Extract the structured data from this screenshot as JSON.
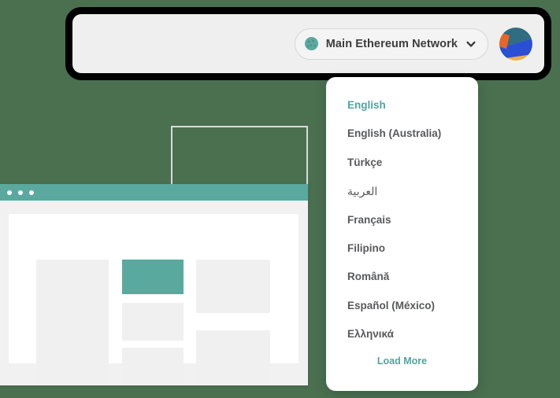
{
  "background": {
    "color": "#4a7050"
  },
  "header": {
    "panel_bg": "#efefef",
    "border_color": "#000000",
    "network_selector": {
      "label": "Main Ethereum Network",
      "status_dot_color": "#5aa99f",
      "chevron_icon": "chevron-down-icon"
    },
    "account_avatar": {
      "icon": "account-identicon-avatar",
      "colors": [
        "#2f6d83",
        "#2b4fd4",
        "#e8b04b",
        "#e8662a"
      ]
    }
  },
  "language_dropdown": {
    "accent_color": "#4fa59c",
    "text_color": "#58595b",
    "items": [
      {
        "label": "English",
        "active": true,
        "rtl": false
      },
      {
        "label": "English (Australia)",
        "active": false,
        "rtl": false
      },
      {
        "label": "Türkçe",
        "active": false,
        "rtl": false
      },
      {
        "label": "العربية",
        "active": false,
        "rtl": true
      },
      {
        "label": "Français",
        "active": false,
        "rtl": false
      },
      {
        "label": "Filipino",
        "active": false,
        "rtl": false
      },
      {
        "label": "Română",
        "active": false,
        "rtl": false
      },
      {
        "label": "Español (México)",
        "active": false,
        "rtl": false
      },
      {
        "label": "Ελληνικά",
        "active": false,
        "rtl": false
      }
    ],
    "load_more_label": "Load More"
  },
  "browser_mockup": {
    "titlebar_color": "#5aa99f",
    "traffic_lights": 3,
    "page_bg": "#ffffff",
    "blocks": [
      {
        "name": "block-left-tall",
        "accent": false
      },
      {
        "name": "block-mid-top",
        "accent": true
      },
      {
        "name": "block-mid-middle",
        "accent": false
      },
      {
        "name": "block-mid-bottom",
        "accent": false
      },
      {
        "name": "block-right-top",
        "accent": false
      },
      {
        "name": "block-right-bottom",
        "accent": false
      }
    ]
  },
  "ghost_rectangle": {
    "border_color": "#d8dcd8"
  }
}
